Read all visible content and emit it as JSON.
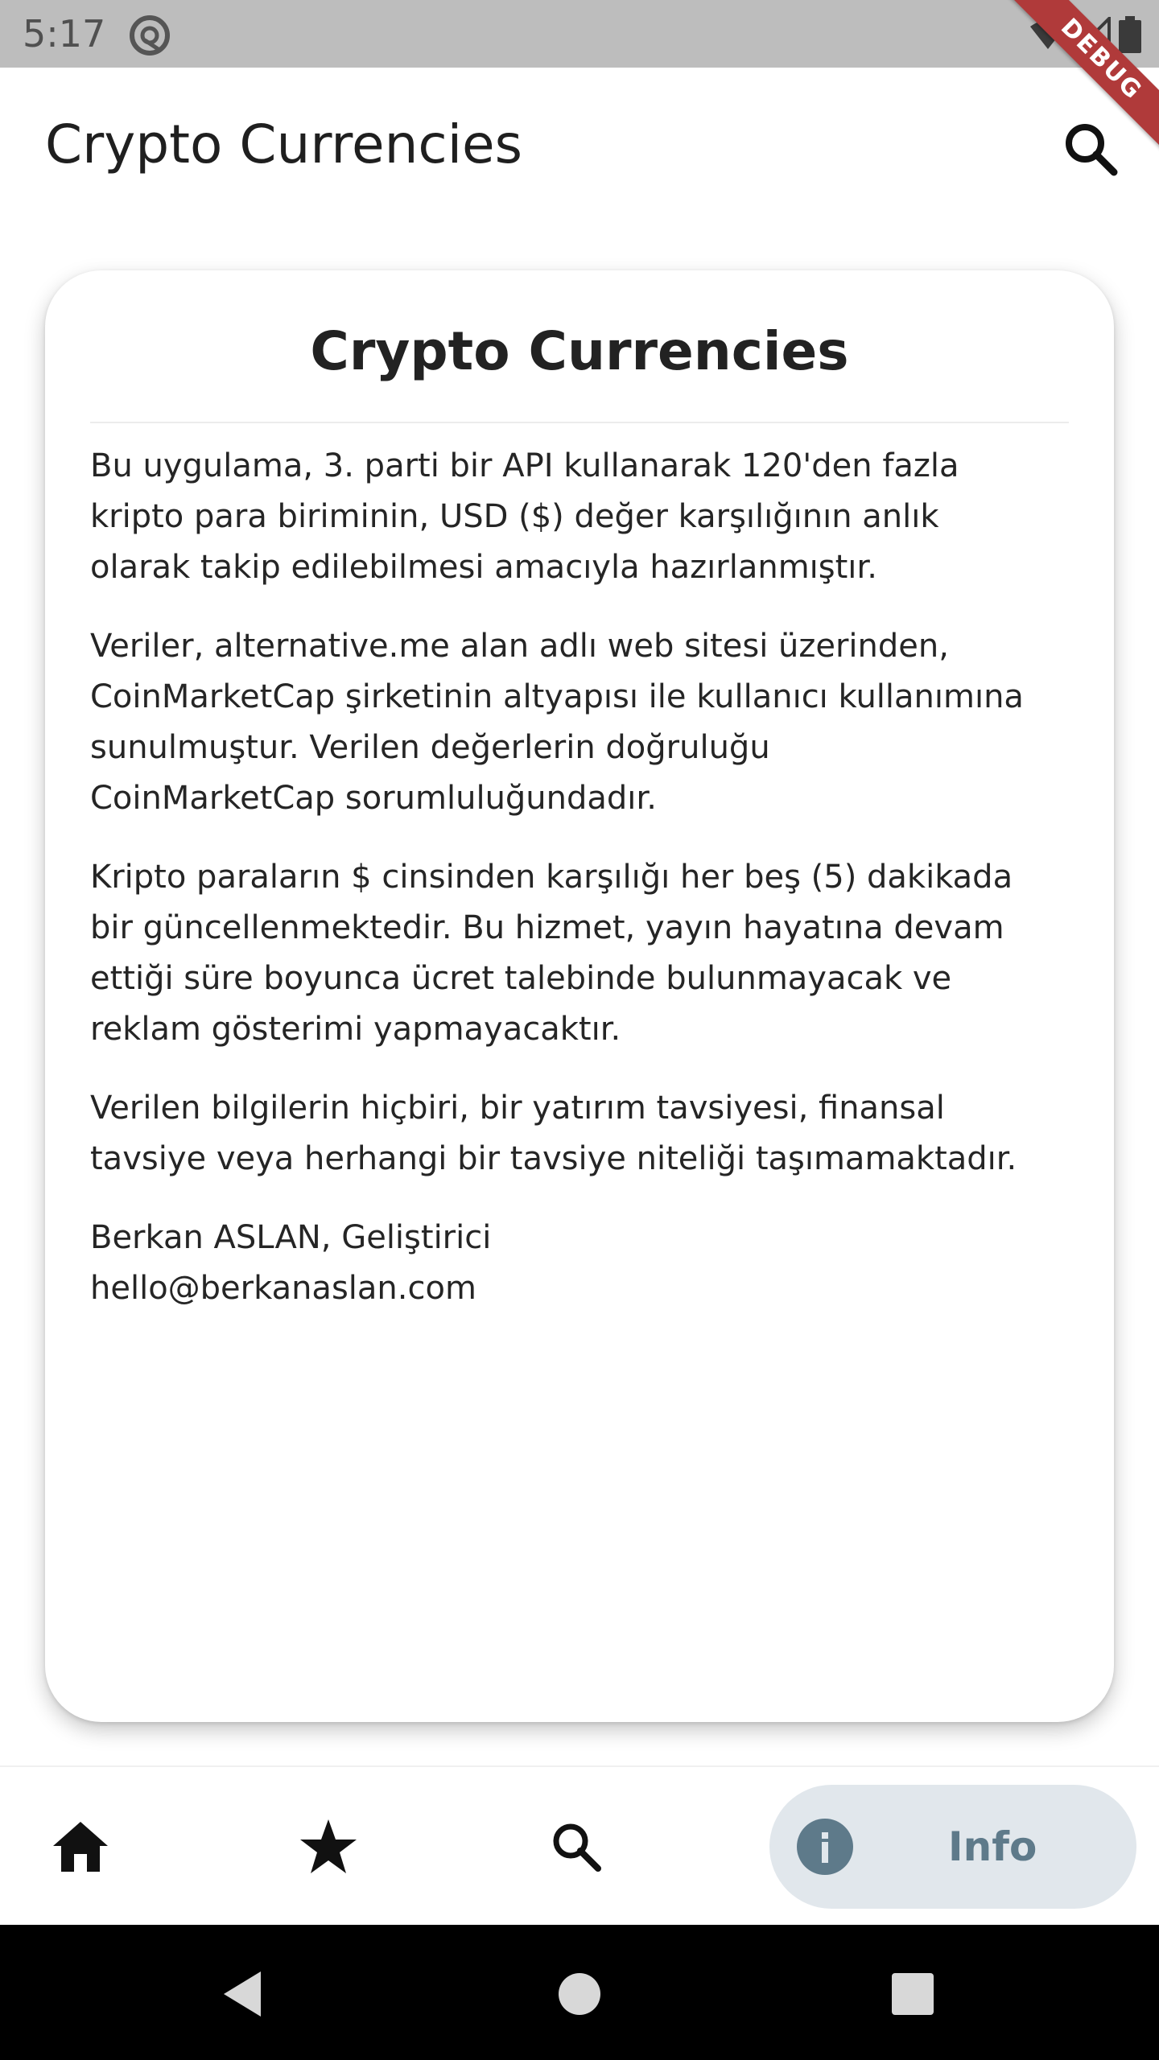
{
  "status_bar": {
    "time": "5:17"
  },
  "debug_banner": "DEBUG",
  "app_bar": {
    "title": "Crypto Currencies",
    "search_icon": "search-icon"
  },
  "card": {
    "title": "Crypto Currencies",
    "paragraphs": [
      {
        "lines": [
          "Bu uygulama, 3. parti bir API kullanarak 120'den fazla",
          "kripto para biriminin, USD ($) değer karşılığının anlık",
          "olarak takip edilebilmesi amacıyla hazırlanmıştır."
        ]
      },
      {
        "lines": [
          "Veriler, alternative.me alan adlı web sitesi üzerinden,",
          "CoinMarketCap şirketinin altyapısı ile kullanıcı kullanımına",
          "sunulmuştur. Verilen değerlerin doğruluğu",
          "CoinMarketCap sorumluluğundadır."
        ]
      },
      {
        "lines": [
          "Kripto paraların $ cinsinden karşılığı her beş (5) dakikada",
          "bir güncellenmektedir. Bu hizmet, yayın hayatına devam",
          "ettiği süre boyunca ücret talebinde bulunmayacak ve",
          "reklam gösterimi yapmayacaktır."
        ]
      },
      {
        "lines": [
          "Verilen bilgilerin hiçbiri, bir yatırım tavsiyesi, finansal",
          "tavsiye veya herhangi bir tavsiye niteliği taşımamaktadır."
        ]
      },
      {
        "lines": [
          "Berkan ASLAN, Geliştirici",
          "hello@berkanaslan.com"
        ]
      }
    ]
  },
  "bottom_nav": {
    "items": [
      {
        "icon": "home-icon"
      },
      {
        "icon": "star-icon"
      },
      {
        "icon": "search-icon"
      },
      {
        "icon": "info-icon",
        "label": "Info",
        "selected": true
      }
    ],
    "selected_bg": "#e1e7ec",
    "selected_fg": "#5e7a8a"
  },
  "system_nav": {
    "buttons": [
      "back-icon",
      "home-circle-icon",
      "recents-icon"
    ]
  }
}
